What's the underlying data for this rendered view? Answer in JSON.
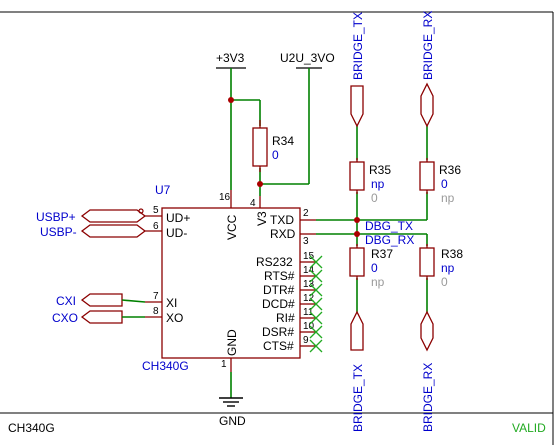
{
  "sheet": {
    "name": "CH340G",
    "status": "VALID"
  },
  "power": {
    "vcc": "+3V3",
    "u2u": "U2U_3VO",
    "gnd": "GND"
  },
  "u7": {
    "ref": "U7",
    "value": "CH340G",
    "pins_left": [
      {
        "name": "UD+",
        "num": "5"
      },
      {
        "name": "UD-",
        "num": "6"
      },
      {
        "name": "XI",
        "num": "7"
      },
      {
        "name": "XO",
        "num": "8"
      }
    ],
    "pins_top": [
      {
        "name": "VCC",
        "num": "16"
      },
      {
        "name": "V3",
        "num": "4"
      }
    ],
    "pins_right": [
      {
        "name": "TXD",
        "num": "2"
      },
      {
        "name": "RXD",
        "num": "3"
      },
      {
        "name": "RS232",
        "num": "15"
      },
      {
        "name": "RTS#",
        "num": "14"
      },
      {
        "name": "DTR#",
        "num": "13"
      },
      {
        "name": "DCD#",
        "num": "12"
      },
      {
        "name": "RI#",
        "num": "11"
      },
      {
        "name": "DSR#",
        "num": "10"
      },
      {
        "name": "CTS#",
        "num": "9"
      }
    ],
    "pins_bottom": [
      {
        "name": "GND",
        "num": "1"
      }
    ]
  },
  "ports": {
    "usbp": "USBP+",
    "usbm": "USBP-",
    "cxi": "CXI",
    "cxo": "CXO",
    "bridge_tx_top": "BRIDGE_TX",
    "bridge_rx_top": "BRIDGE_RX",
    "bridge_tx_bottom": "BRIDGE_TX",
    "bridge_rx_bottom": "BRIDGE_RX"
  },
  "nets": {
    "dbg_tx": "DBG_TX",
    "dbg_rx": "DBG_RX"
  },
  "resistors": {
    "r34": {
      "ref": "R34",
      "value": "0"
    },
    "r35": {
      "ref": "R35",
      "value": "np",
      "value2": "0"
    },
    "r36": {
      "ref": "R36",
      "value": "0",
      "value2": "np"
    },
    "r37": {
      "ref": "R37",
      "value": "0",
      "value2": "np"
    },
    "r38": {
      "ref": "R38",
      "value": "np",
      "value2": "0"
    }
  }
}
